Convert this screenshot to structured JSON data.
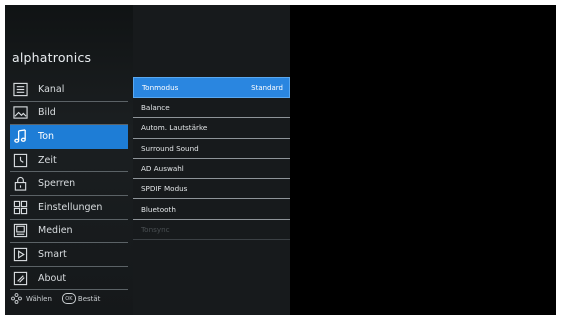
{
  "brand": "alphatronics",
  "menu": [
    {
      "label": "Kanal",
      "icon": "list-icon"
    },
    {
      "label": "Bild",
      "icon": "picture-icon"
    },
    {
      "label": "Ton",
      "icon": "music-note-icon"
    },
    {
      "label": "Zeit",
      "icon": "clock-icon"
    },
    {
      "label": "Sperren",
      "icon": "lock-icon"
    },
    {
      "label": "Einstellungen",
      "icon": "settings-grid-icon"
    },
    {
      "label": "Medien",
      "icon": "media-icon"
    },
    {
      "label": "Smart",
      "icon": "smart-play-icon"
    },
    {
      "label": "About",
      "icon": "info-icon"
    }
  ],
  "active_menu": "Ton",
  "submenu": [
    {
      "label": "Tonmodus",
      "value": "Standard"
    },
    {
      "label": "Balance",
      "value": ""
    },
    {
      "label": "Autom. Lautstärke",
      "value": ""
    },
    {
      "label": "Surround Sound",
      "value": ""
    },
    {
      "label": "AD Auswahl",
      "value": ""
    },
    {
      "label": "SPDIF Modus",
      "value": ""
    },
    {
      "label": "Bluetooth",
      "value": ""
    },
    {
      "label": "Tonsync",
      "value": ""
    }
  ],
  "footer": {
    "select_label": "Wählen",
    "ok_label": "OK",
    "confirm_label": "Bestät"
  },
  "colors": {
    "accent": "#1e7dd6",
    "background": "#000000",
    "panel": "#171a1c"
  }
}
